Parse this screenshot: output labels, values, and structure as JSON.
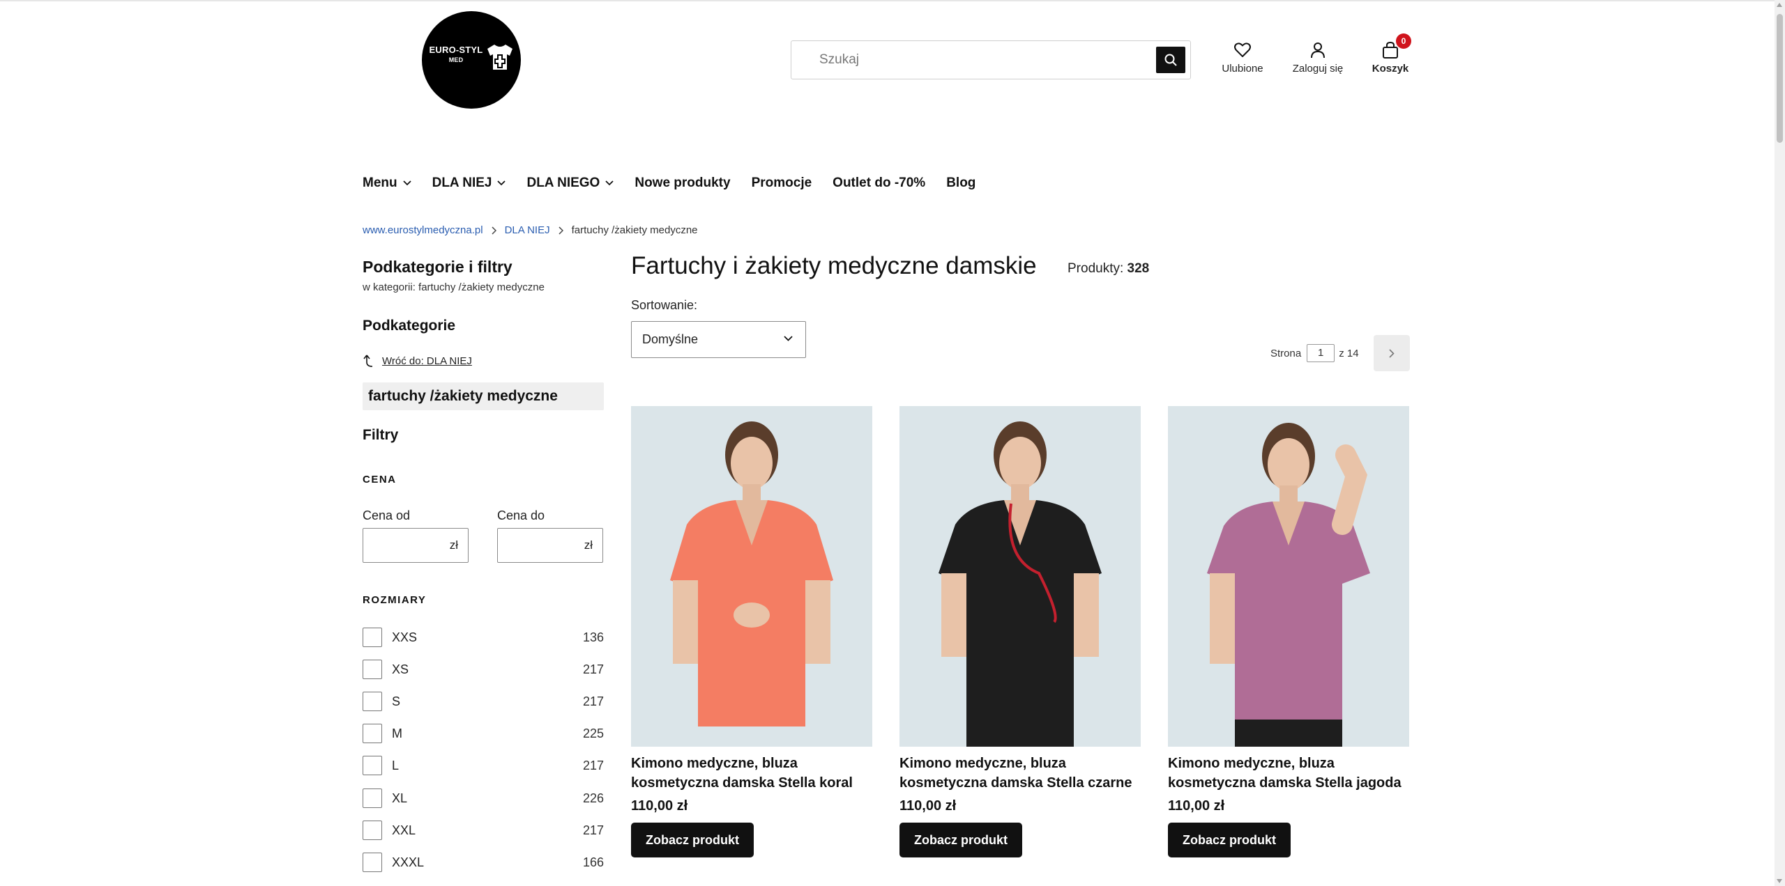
{
  "header": {
    "logo_line1": "EURO-STYL",
    "logo_line2": "MED",
    "search_placeholder": "Szukaj",
    "favorites_label": "Ulubione",
    "login_label": "Zaloguj się",
    "cart_label": "Koszyk",
    "cart_count": "0"
  },
  "nav": {
    "items": [
      {
        "label": "Menu",
        "has_dropdown": true
      },
      {
        "label": "DLA NIEJ",
        "has_dropdown": true
      },
      {
        "label": "DLA NIEGO",
        "has_dropdown": true
      },
      {
        "label": "Nowe produkty",
        "has_dropdown": false
      },
      {
        "label": "Promocje",
        "has_dropdown": false
      },
      {
        "label": "Outlet do -70%",
        "has_dropdown": false
      },
      {
        "label": "Blog",
        "has_dropdown": false
      }
    ]
  },
  "breadcrumb": {
    "items": [
      "www.eurostylmedyczna.pl",
      "DLA NIEJ",
      "fartuchy /żakiety medyczne"
    ]
  },
  "sidebar": {
    "title": "Podkategorie i filtry",
    "subtitle": "w kategorii: fartuchy /żakiety medyczne",
    "subcategories_heading": "Podkategorie",
    "back_link": "Wróć do: DLA NIEJ",
    "active_category": "fartuchy /żakiety medyczne",
    "filters_heading": "Filtry",
    "price_heading": "CENA",
    "price_from_label": "Cena od",
    "price_to_label": "Cena do",
    "currency": "zł",
    "sizes_heading": "ROZMIARY",
    "sizes": [
      {
        "label": "XXS",
        "count": "136"
      },
      {
        "label": "XS",
        "count": "217"
      },
      {
        "label": "S",
        "count": "217"
      },
      {
        "label": "M",
        "count": "225"
      },
      {
        "label": "L",
        "count": "217"
      },
      {
        "label": "XL",
        "count": "226"
      },
      {
        "label": "XXL",
        "count": "217"
      },
      {
        "label": "XXXL",
        "count": "166"
      }
    ]
  },
  "main": {
    "title": "Fartuchy i żakiety medyczne damskie",
    "products_label": "Produkty:",
    "products_count": "328",
    "sort_label": "Sortowanie:",
    "sort_value": "Domyślne",
    "pager_label": "Strona",
    "pager_current": "1",
    "pager_total": "z 14"
  },
  "products": [
    {
      "name": "Kimono medyczne, bluza kosmetyczna damska Stella koral",
      "price": "110,00 zł",
      "button": "Zobacz produkt",
      "garment_color": "#f47d63"
    },
    {
      "name": "Kimono medyczne, bluza kosmetyczna damska Stella czarne",
      "price": "110,00 zł",
      "button": "Zobacz produkt",
      "garment_color": "#1e1e1e"
    },
    {
      "name": "Kimono medyczne, bluza kosmetyczna damska Stella jagoda",
      "price": "110,00 zł",
      "button": "Zobacz produkt",
      "garment_color": "#b06d96"
    }
  ]
}
